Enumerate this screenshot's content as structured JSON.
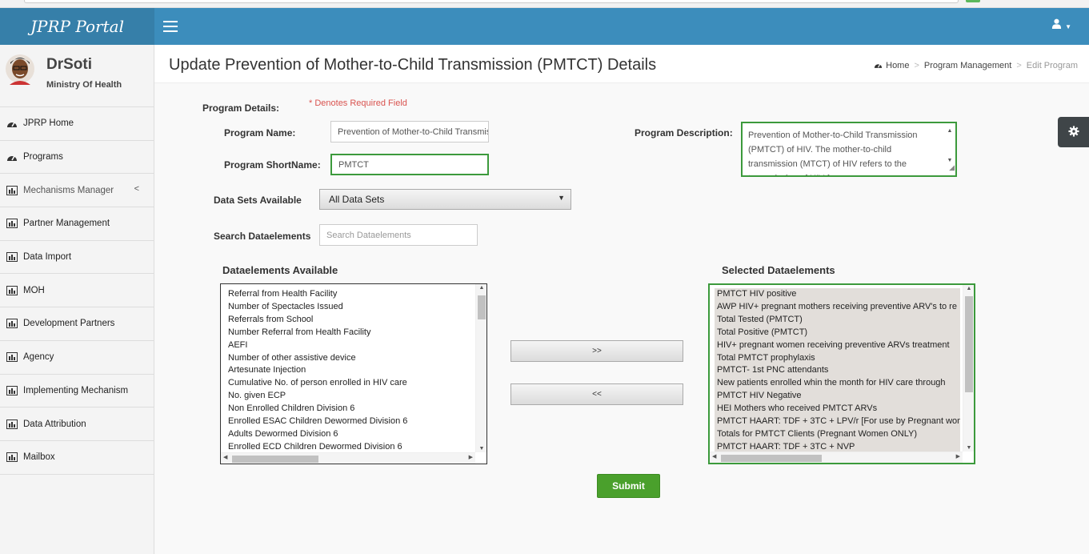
{
  "app": {
    "logo": "JPRP Portal"
  },
  "user": {
    "name": "DrSoti",
    "org": "Ministry Of Health"
  },
  "sidebar": {
    "items": [
      {
        "label": "JPRP Home",
        "icon": "dashboard-icon"
      },
      {
        "label": "Programs",
        "icon": "dashboard-icon"
      },
      {
        "label": "Mechanisms Manager",
        "icon": "bar-chart-icon"
      },
      {
        "label": "Partner Management",
        "icon": "bar-chart-icon"
      },
      {
        "label": "Data Import",
        "icon": "bar-chart-icon"
      },
      {
        "label": "MOH",
        "icon": "bar-chart-icon"
      },
      {
        "label": "Development Partners",
        "icon": "bar-chart-icon"
      },
      {
        "label": "Agency",
        "icon": "bar-chart-icon"
      },
      {
        "label": "Implementing Mechanism",
        "icon": "bar-chart-icon"
      },
      {
        "label": "Data Attribution",
        "icon": "bar-chart-icon"
      },
      {
        "label": "Mailbox",
        "icon": "bar-chart-icon"
      }
    ]
  },
  "header": {
    "title": "Update Prevention of Mother-to-Child Transmission (PMTCT) Details",
    "breadcrumb": [
      "Home",
      "Program Management",
      "Edit Program"
    ]
  },
  "form": {
    "section_label": "Program Details:",
    "required_note": "* Denotes Required Field",
    "program_name_label": "Program Name:",
    "program_name_value": "Prevention of Mother-to-Child Transmission (PMTCT)",
    "program_shortname_label": "Program ShortName:",
    "program_shortname_value": "PMTCT",
    "program_description_label": "Program Description:",
    "program_description_value": "Prevention of Mother-to-Child Transmission (PMTCT) of HIV. The mother-to-child transmission (MTCT) of HIV refers to the transmission of HIV from",
    "datasets_label": "Data Sets Available",
    "datasets_selected": "All Data Sets",
    "search_label": "Search Dataelements",
    "search_placeholder": "Search Dataelements",
    "available_title": "Dataelements Available",
    "selected_title": "Selected Dataelements",
    "add_button": ">>",
    "remove_button": "<<",
    "submit_button": "Submit"
  },
  "available_items": [
    "Referral from Health Facility",
    "Number of Spectacles Issued",
    "Referrals from School",
    "Number Referral from Health Facility",
    "AEFI",
    "Number of other assistive device",
    "Artesunate Injection",
    "Cumulative No. of person enrolled in HIV care",
    "No. given ECP",
    "Non Enrolled Children Division 6",
    "Enrolled ESAC Children Dewormed Division 6",
    "Adults Dewormed Division 6",
    "Enrolled ECD Children Dewormed Division 6"
  ],
  "selected_items": [
    "PMTCT HIV positive",
    "AWP HIV+ pregnant mothers receiving preventive ARV's to re",
    "Total Tested (PMTCT)",
    "Total Positive (PMTCT)",
    "HIV+ pregnant women receiving preventive ARVs treatment",
    "Total PMTCT prophylaxis",
    "PMTCT- 1st PNC attendants",
    "New patients enrolled whin the month for HIV care through",
    "PMTCT HIV Negative",
    "HEI Mothers who received PMTCT ARVs",
    "PMTCT HAART: TDF + 3TC + LPV/r [For use by Pregnant wom",
    "Totals for PMTCT Clients (Pregnant Women ONLY)",
    "PMTCT HAART: TDF + 3TC + NVP"
  ]
}
